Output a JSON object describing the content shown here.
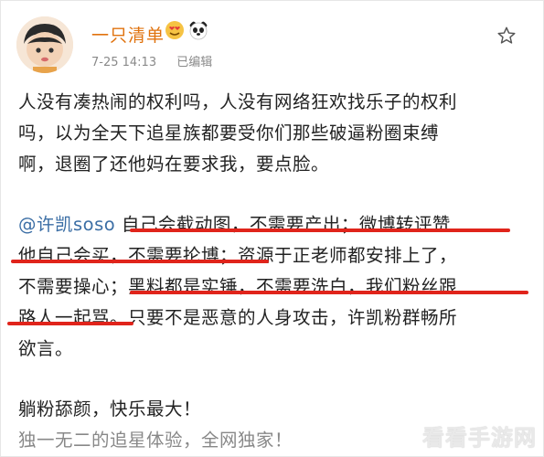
{
  "post": {
    "username": "一只清单",
    "time": "7-25 14:13",
    "edited": "已编辑"
  },
  "body": {
    "p1_l1": "人没有凑热闹的权利吗，人没有网络狂欢找乐子的权利",
    "p1_l2": "吗，以为全天下追星族都要受你们那些破逼粉圈束缚",
    "p1_l3": "啊，退圈了还他妈在要求我，要点脸。",
    "mention": "@许凯soso",
    "p2_l1_rest": " 自己会截动图，不需要产出；微博转评赞",
    "p2_l2": "他自己会买，不需要抡博；资源于正老师都安排上了，",
    "p2_l3": "不需要操心；黑料都是实锤，不需要洗白，我们粉丝跟",
    "p2_l4": "路人一起骂。只要不是恶意的人身攻击，许凯粉群畅所",
    "p2_l5": "欲言。",
    "p3_l1": "躺粉舔颜，快乐最大！",
    "p3_l2": "独一无二的追星体验，全网独家！"
  },
  "watermark": "看看手游网",
  "colors": {
    "username": "#e0730f",
    "mention": "#3b6ea5",
    "underline": "#e0241b"
  }
}
